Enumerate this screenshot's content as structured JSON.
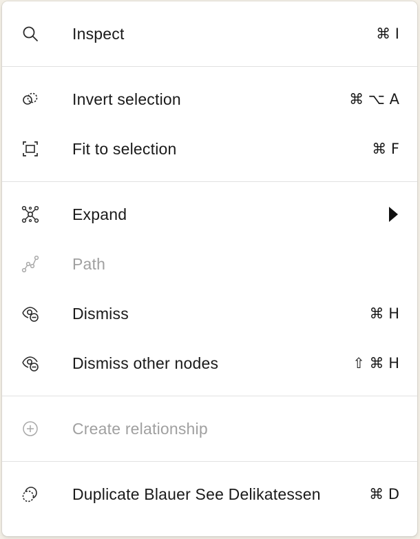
{
  "menu": {
    "inspect": {
      "label": "Inspect",
      "shortcut": "⌘ I",
      "icon": "search-icon"
    },
    "invert_selection": {
      "label": "Invert selection",
      "shortcut": "⌘ ⌥ A",
      "icon": "invert-selection-icon"
    },
    "fit_to_selection": {
      "label": "Fit to selection",
      "shortcut": "⌘ F",
      "icon": "fit-frame-icon"
    },
    "expand": {
      "label": "Expand",
      "icon": "expand-graph-icon",
      "submenu_icon": "caret-right-icon"
    },
    "path": {
      "label": "Path",
      "icon": "path-icon",
      "disabled": true
    },
    "dismiss": {
      "label": "Dismiss",
      "shortcut": "⌘ H",
      "icon": "eye-minus-icon"
    },
    "dismiss_other": {
      "label": "Dismiss other nodes",
      "shortcut": "⇧ ⌘ H",
      "icon": "eye-minus-icon"
    },
    "create_relationship": {
      "label": "Create relationship",
      "icon": "plus-circle-icon",
      "disabled": true
    },
    "duplicate": {
      "label": "Duplicate Blauer See Delikatessen",
      "shortcut": "⌘ D",
      "icon": "duplicate-node-icon"
    }
  },
  "colors": {
    "text": "#1a1a1a",
    "disabled_text": "#a0a0a0",
    "divider": "#e1e1e1",
    "background": "#ffffff"
  }
}
